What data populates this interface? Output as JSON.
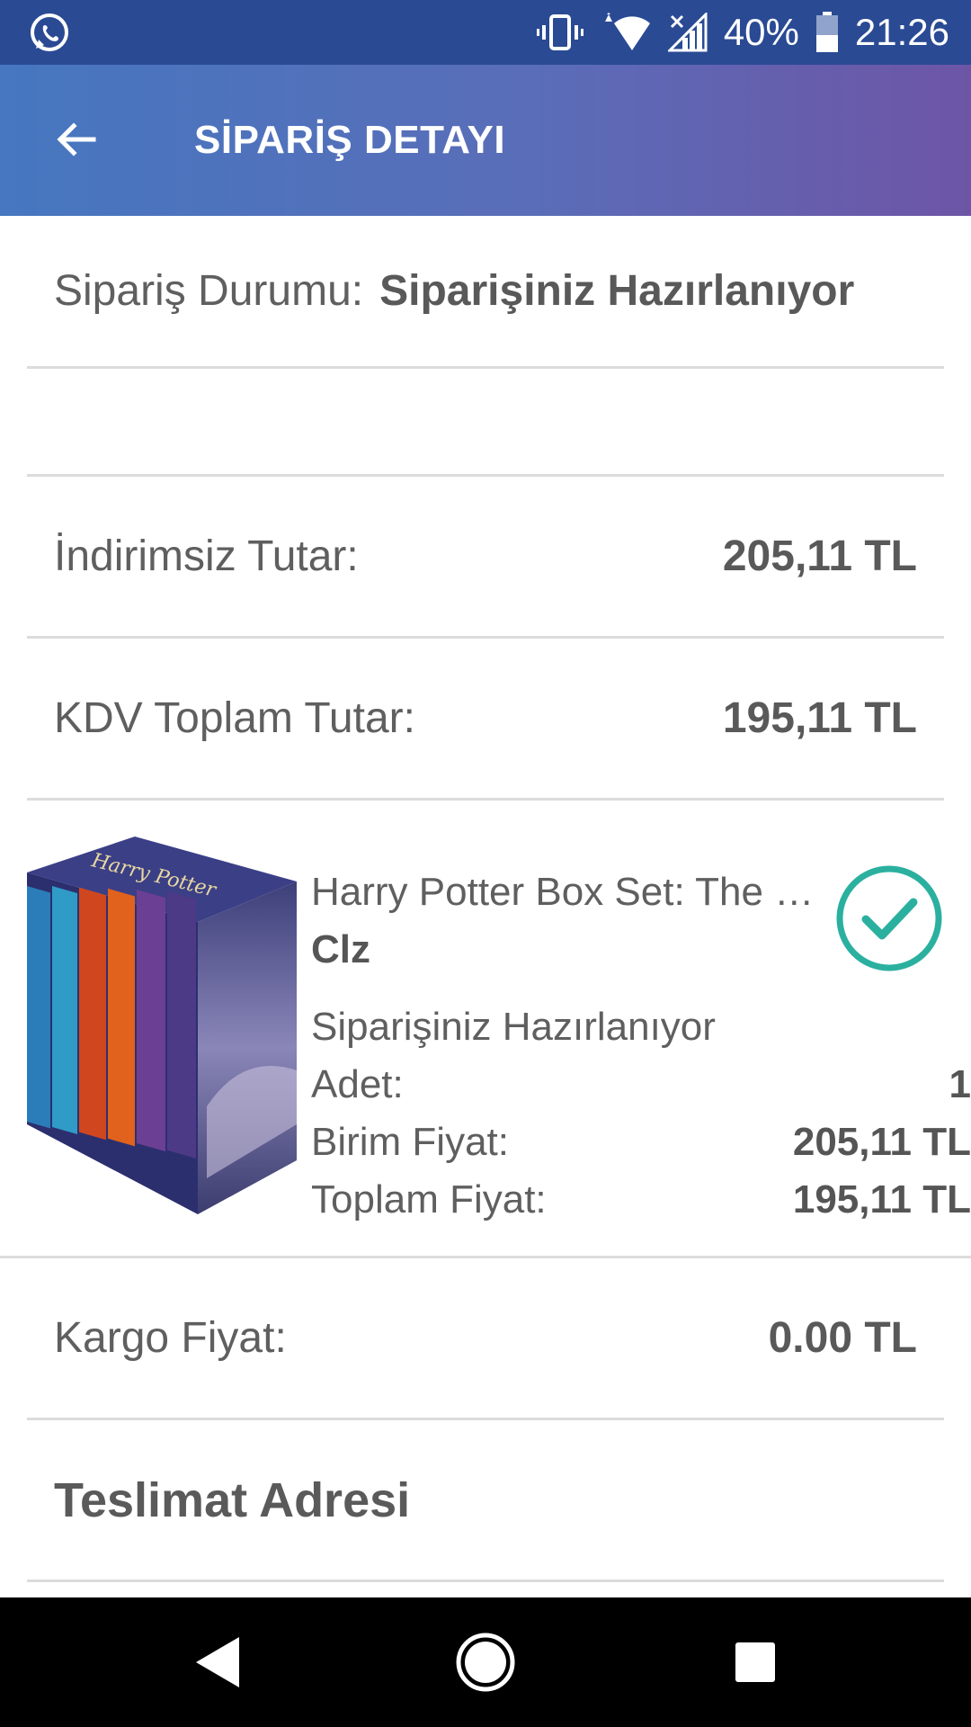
{
  "status_bar": {
    "battery": "40%",
    "time": "21:26"
  },
  "app_bar": {
    "title": "SİPARİŞ DETAYI"
  },
  "order": {
    "status_label": "Sipariş Durumu:",
    "status_value": "Siparişiniz Hazırlanıyor",
    "undiscounted_label": "İndirimsiz Tutar:",
    "undiscounted_value": "205,11 TL",
    "vat_total_label": "KDV Toplam Tutar:",
    "vat_total_value": "195,11 TL",
    "shipping_label": "Kargo Fiyat:",
    "shipping_value": "0.00 TL",
    "address_heading": "Teslimat Adresi"
  },
  "product": {
    "name": "Harry Potter Box Set: The Complete Collection",
    "seller": "Clz",
    "state": "Siparişiniz Hazırlanıyor",
    "quantity_label": "Adet:",
    "quantity_value": "1",
    "unit_price_label": "Birim Fiyat:",
    "unit_price_value": "205,11 TL",
    "total_price_label": "Toplam Fiyat:",
    "total_price_value": "195,11 TL",
    "check_color": "#2bb0a0"
  },
  "colors": {
    "status_bar": "#2a4a94",
    "app_bar_start": "#4677c0",
    "app_bar_end": "#6d55a6"
  }
}
